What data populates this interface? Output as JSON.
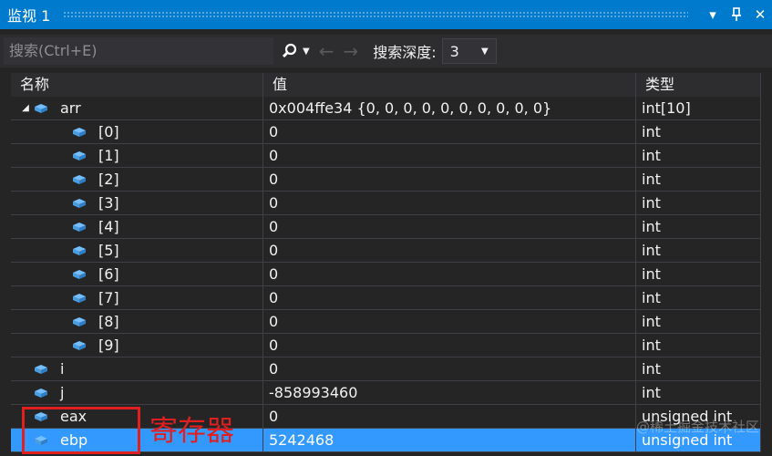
{
  "window": {
    "title": "监视 1",
    "dropdown_icon": "chevron-down-icon",
    "pin_icon": "pin-icon",
    "close_icon": "close-icon"
  },
  "search": {
    "placeholder": "搜索(Ctrl+E)",
    "depth_label": "搜索深度:",
    "depth_value": "3"
  },
  "columns": {
    "name": "名称",
    "value": "值",
    "type": "类型"
  },
  "rows": [
    {
      "name": "arr",
      "value": "0x004ffe34 {0, 0, 0, 0, 0, 0, 0, 0, 0, 0}",
      "type": "int[10]",
      "expanded": true,
      "level": 0
    },
    {
      "name": "[0]",
      "value": "0",
      "type": "int",
      "level": 1
    },
    {
      "name": "[1]",
      "value": "0",
      "type": "int",
      "level": 1
    },
    {
      "name": "[2]",
      "value": "0",
      "type": "int",
      "level": 1
    },
    {
      "name": "[3]",
      "value": "0",
      "type": "int",
      "level": 1
    },
    {
      "name": "[4]",
      "value": "0",
      "type": "int",
      "level": 1
    },
    {
      "name": "[5]",
      "value": "0",
      "type": "int",
      "level": 1
    },
    {
      "name": "[6]",
      "value": "0",
      "type": "int",
      "level": 1
    },
    {
      "name": "[7]",
      "value": "0",
      "type": "int",
      "level": 1
    },
    {
      "name": "[8]",
      "value": "0",
      "type": "int",
      "level": 1
    },
    {
      "name": "[9]",
      "value": "0",
      "type": "int",
      "level": 1
    },
    {
      "name": "i",
      "value": "0",
      "type": "int",
      "level": 0
    },
    {
      "name": "j",
      "value": "-858993460",
      "type": "int",
      "level": 0
    },
    {
      "name": "eax",
      "value": "0",
      "type": "unsigned int",
      "level": 0
    },
    {
      "name": "ebp",
      "value": "5242468",
      "type": "unsigned int",
      "level": 0,
      "selected": true
    }
  ],
  "annotation": {
    "label": "寄存器",
    "color": "#e02020"
  },
  "watermark": "@稀土掘金技术社区",
  "colors": {
    "accent": "#007acc",
    "selection": "#3399ff",
    "icon": "#75beff"
  }
}
